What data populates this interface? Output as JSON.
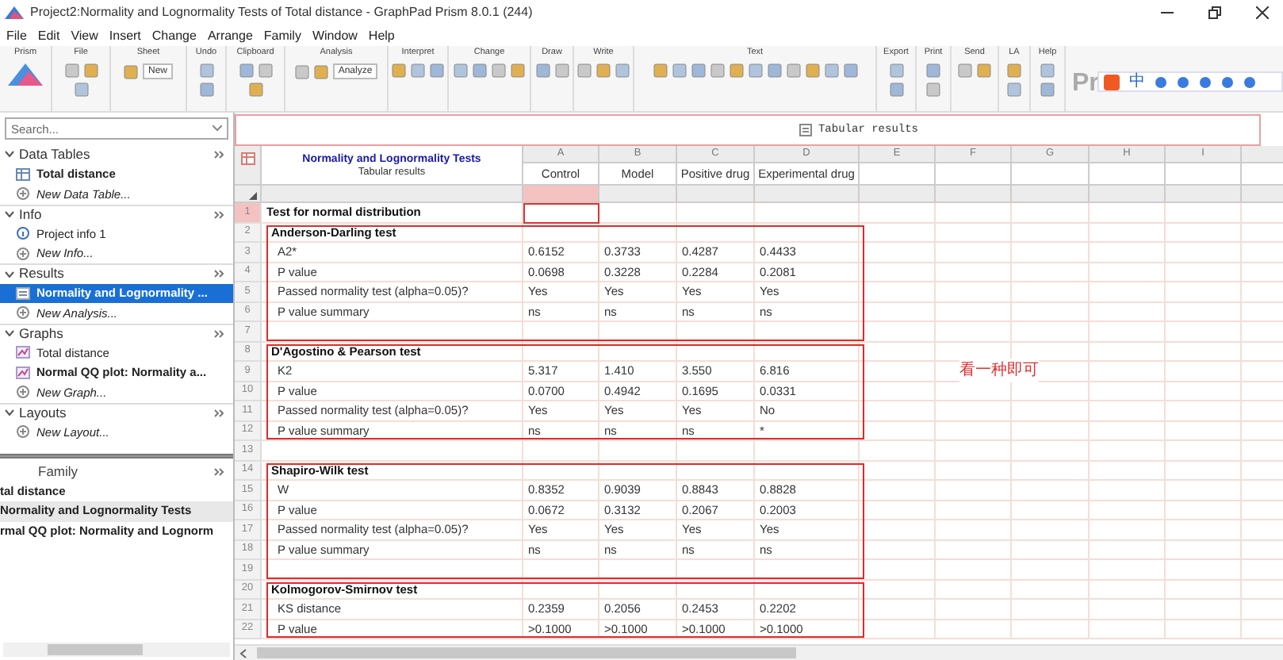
{
  "window": {
    "title": "Project2:Normality and Lognormality Tests of Total distance - GraphPad Prism 8.0.1 (244)"
  },
  "menu": [
    "File",
    "Edit",
    "View",
    "Insert",
    "Change",
    "Arrange",
    "Family",
    "Window",
    "Help"
  ],
  "ribbon": {
    "groups": [
      {
        "label": "Prism"
      },
      {
        "label": "File"
      },
      {
        "label": "Sheet",
        "button": "New"
      },
      {
        "label": "Undo"
      },
      {
        "label": "Clipboard"
      },
      {
        "label": "Analysis",
        "button": "Analyze"
      },
      {
        "label": "Interpret"
      },
      {
        "label": "Change"
      },
      {
        "label": "Draw"
      },
      {
        "label": "Write"
      },
      {
        "label": "Text"
      },
      {
        "label": "Export"
      },
      {
        "label": "Print"
      },
      {
        "label": "Send"
      },
      {
        "label": "LA"
      },
      {
        "label": "Help"
      }
    ],
    "logo": "Pr",
    "ime_label": "中"
  },
  "sidebar": {
    "search_placeholder": "Search...",
    "sections": [
      {
        "title": "Data Tables",
        "expanded": true,
        "items": [
          {
            "kind": "table",
            "label": "Total distance",
            "bold": true,
            "selected": false
          },
          {
            "kind": "new",
            "label": "New Data Table...",
            "bold": false,
            "selected": false
          }
        ]
      },
      {
        "title": "Info",
        "expanded": true,
        "items": [
          {
            "kind": "info",
            "label": "Project info 1",
            "bold": false,
            "selected": false
          },
          {
            "kind": "new",
            "label": "New Info...",
            "bold": false,
            "selected": false
          }
        ]
      },
      {
        "title": "Results",
        "expanded": true,
        "items": [
          {
            "kind": "results",
            "label": "Normality and Lognormality ...",
            "bold": true,
            "selected": true
          },
          {
            "kind": "new",
            "label": "New Analysis...",
            "bold": false,
            "selected": false
          }
        ]
      },
      {
        "title": "Graphs",
        "expanded": true,
        "items": [
          {
            "kind": "graph",
            "label": "Total distance",
            "bold": false,
            "selected": false
          },
          {
            "kind": "graph",
            "label": "Normal QQ plot: Normality a...",
            "bold": true,
            "selected": false
          },
          {
            "kind": "new",
            "label": "New Graph...",
            "bold": false,
            "selected": false
          }
        ]
      },
      {
        "title": "Layouts",
        "expanded": true,
        "items": [
          {
            "kind": "new",
            "label": "New Layout...",
            "bold": false,
            "selected": false
          }
        ]
      }
    ],
    "family": {
      "title": "Family",
      "items": [
        {
          "label": "tal distance",
          "selected": false
        },
        {
          "label": "Normality and Lognormality Tests",
          "selected": true
        },
        {
          "label": "rmal QQ plot: Normality and Lognorm",
          "selected": false
        }
      ]
    }
  },
  "sheet": {
    "tab": "Tabular results",
    "title": "Normality and Lognormality Tests",
    "subtitle": "Tabular results",
    "columns": [
      {
        "letter": "A",
        "name": "Control",
        "selected": true
      },
      {
        "letter": "B",
        "name": "Model",
        "selected": false
      },
      {
        "letter": "C",
        "name": "Positive drug",
        "selected": false
      },
      {
        "letter": "D",
        "name": "Experimental drug",
        "selected": false
      },
      {
        "letter": "E",
        "selected": false
      },
      {
        "letter": "F",
        "selected": false
      },
      {
        "letter": "G",
        "selected": false
      },
      {
        "letter": "H",
        "selected": false
      },
      {
        "letter": "I",
        "selected": false
      }
    ],
    "blocks": [
      {
        "boxed": false,
        "rows": [
          {
            "number": "1",
            "kind": "heading",
            "label": "Test for normal distribution",
            "selected": true
          }
        ]
      },
      {
        "boxed": true,
        "rows": [
          {
            "number": "2",
            "kind": "section",
            "label": "Anderson-Darling test",
            "selected": false
          },
          {
            "number": "3",
            "kind": "data",
            "label": "A2*",
            "values": [
              "0.6152",
              "0.3733",
              "0.4287",
              "0.4433"
            ],
            "selected": false
          },
          {
            "number": "4",
            "kind": "data",
            "label": "P value",
            "values": [
              "0.0698",
              "0.3228",
              "0.2284",
              "0.2081"
            ],
            "selected": false
          },
          {
            "number": "5",
            "kind": "data",
            "label": "Passed normality test (alpha=0.05)?",
            "values": [
              "Yes",
              "Yes",
              "Yes",
              "Yes"
            ],
            "selected": false
          },
          {
            "number": "6",
            "kind": "data",
            "label": "P value summary",
            "values": [
              "ns",
              "ns",
              "ns",
              "ns"
            ],
            "selected": false
          },
          {
            "number": "7",
            "kind": "blank",
            "selected": false
          }
        ]
      },
      {
        "boxed": true,
        "rows": [
          {
            "number": "8",
            "kind": "section",
            "label": "D'Agostino & Pearson test",
            "selected": false
          },
          {
            "number": "9",
            "kind": "data",
            "label": "K2",
            "values": [
              "5.317",
              "1.410",
              "3.550",
              "6.816"
            ],
            "selected": false
          },
          {
            "number": "10",
            "kind": "data",
            "label": "P value",
            "values": [
              "0.0700",
              "0.4942",
              "0.1695",
              "0.0331"
            ],
            "selected": false
          },
          {
            "number": "11",
            "kind": "data",
            "label": "Passed normality test (alpha=0.05)?",
            "values": [
              "Yes",
              "Yes",
              "Yes",
              "No"
            ],
            "selected": false
          },
          {
            "number": "12",
            "kind": "data",
            "label": "P value summary",
            "values": [
              "ns",
              "ns",
              "ns",
              "*"
            ],
            "selected": false
          }
        ]
      },
      {
        "boxed": false,
        "rows": [
          {
            "number": "13",
            "kind": "blank",
            "selected": false
          }
        ]
      },
      {
        "boxed": true,
        "rows": [
          {
            "number": "14",
            "kind": "section",
            "label": "Shapiro-Wilk test",
            "selected": false
          },
          {
            "number": "15",
            "kind": "data",
            "label": "W",
            "values": [
              "0.8352",
              "0.9039",
              "0.8843",
              "0.8828"
            ],
            "selected": false
          },
          {
            "number": "16",
            "kind": "data",
            "label": "P value",
            "values": [
              "0.0672",
              "0.3132",
              "0.2067",
              "0.2003"
            ],
            "selected": false
          },
          {
            "number": "17",
            "kind": "data",
            "label": "Passed normality test (alpha=0.05)?",
            "values": [
              "Yes",
              "Yes",
              "Yes",
              "Yes"
            ],
            "selected": false
          },
          {
            "number": "18",
            "kind": "data",
            "label": "P value summary",
            "values": [
              "ns",
              "ns",
              "ns",
              "ns"
            ],
            "selected": false
          },
          {
            "number": "19",
            "kind": "blank",
            "selected": false
          }
        ]
      },
      {
        "boxed": true,
        "rows": [
          {
            "number": "20",
            "kind": "section",
            "label": "Kolmogorov-Smirnov test",
            "selected": false
          },
          {
            "number": "21",
            "kind": "data",
            "label": "KS distance",
            "values": [
              "0.2359",
              "0.2056",
              "0.2453",
              "0.2202"
            ],
            "selected": false
          },
          {
            "number": "22",
            "kind": "data",
            "label": "P value",
            "values": [
              ">0.1000",
              ">0.1000",
              ">0.1000",
              ">0.1000"
            ],
            "selected": false
          }
        ]
      }
    ],
    "note": "看一种即可"
  }
}
